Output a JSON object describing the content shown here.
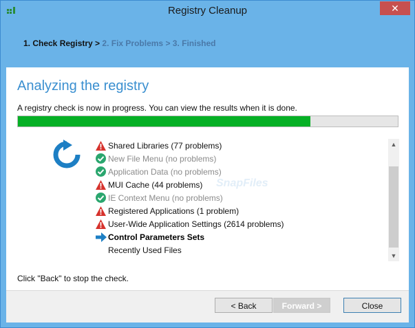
{
  "window": {
    "title": "Registry Cleanup",
    "close_glyph": "✕"
  },
  "wizard_steps": [
    {
      "label": "1. Check Registry >",
      "active": true
    },
    {
      "label": "2. Fix Problems >",
      "active": false
    },
    {
      "label": "3. Finished",
      "active": false
    }
  ],
  "main": {
    "heading": "Analyzing the registry",
    "description": "A registry check is now in progress. You can view the results when it is done.",
    "progress_fraction": 0.77,
    "checklist": [
      {
        "label": "Shared Libraries (77 problems)",
        "status": "problems",
        "icon": "warning-icon"
      },
      {
        "label": "New File Menu (no problems)",
        "status": "ok",
        "icon": "check-icon"
      },
      {
        "label": "Application Data (no problems)",
        "status": "ok",
        "icon": "check-icon"
      },
      {
        "label": "MUI Cache (44 problems)",
        "status": "problems",
        "icon": "warning-icon"
      },
      {
        "label": "IE Context Menu (no problems)",
        "status": "ok",
        "icon": "check-icon"
      },
      {
        "label": "Registered Applications (1 problem)",
        "status": "problems",
        "icon": "warning-icon"
      },
      {
        "label": "User-Wide Application Settings (2614 problems)",
        "status": "problems",
        "icon": "warning-icon"
      },
      {
        "label": "Control Parameters Sets",
        "status": "current",
        "icon": "arrow-right-icon"
      },
      {
        "label": "Recently Used Files",
        "status": "pending",
        "icon": ""
      }
    ],
    "footer_text": "Click \"Back\" to stop the check.",
    "watermark": "SnapFiles"
  },
  "buttons": {
    "back": "< Back",
    "forward": "Forward >",
    "close": "Close"
  },
  "colors": {
    "accent": "#3a8fd0",
    "progress": "#06b025",
    "warning": "#d6322c",
    "ok": "#2aa66e"
  }
}
